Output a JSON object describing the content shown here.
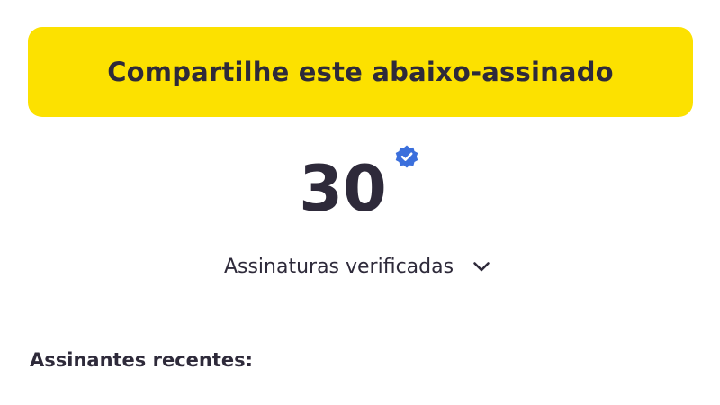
{
  "share": {
    "label": "Compartilhe este abaixo-assinado"
  },
  "signatures": {
    "count": "30",
    "verified_label": "Assinaturas verificadas",
    "verified_icon": "verified-badge-icon",
    "dropdown_icon": "chevron-down-icon"
  },
  "recent": {
    "heading": "Assinantes recentes:"
  },
  "colors": {
    "accent_yellow": "#fce100",
    "text_dark": "#2e2a3a",
    "verified_blue": "#3b6fdc"
  }
}
